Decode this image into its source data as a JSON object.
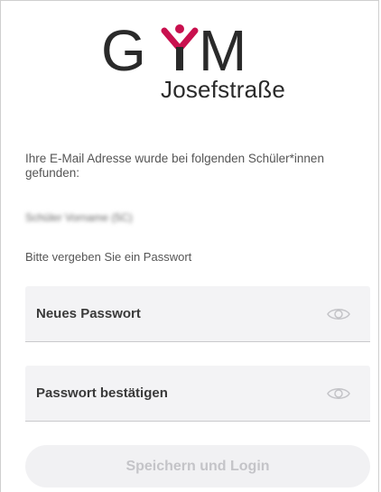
{
  "logo": {
    "main": "GYM",
    "sub": "Josefstraße",
    "accent_color": "#c8104e",
    "dark_color": "#2a2a2a"
  },
  "info_text": "Ihre E-Mail Adresse wurde bei folgenden Schüler*innen gefunden:",
  "student_entry": "Schüler Vorname (5C)",
  "prompt_text": "Bitte vergeben Sie ein Passwort",
  "fields": {
    "new_password": {
      "label": "Neues Passwort",
      "icon": "eye-icon"
    },
    "confirm_password": {
      "label": "Passwort bestätigen",
      "icon": "eye-icon"
    }
  },
  "submit_button": {
    "label": "Speichern und Login",
    "state": "disabled"
  }
}
